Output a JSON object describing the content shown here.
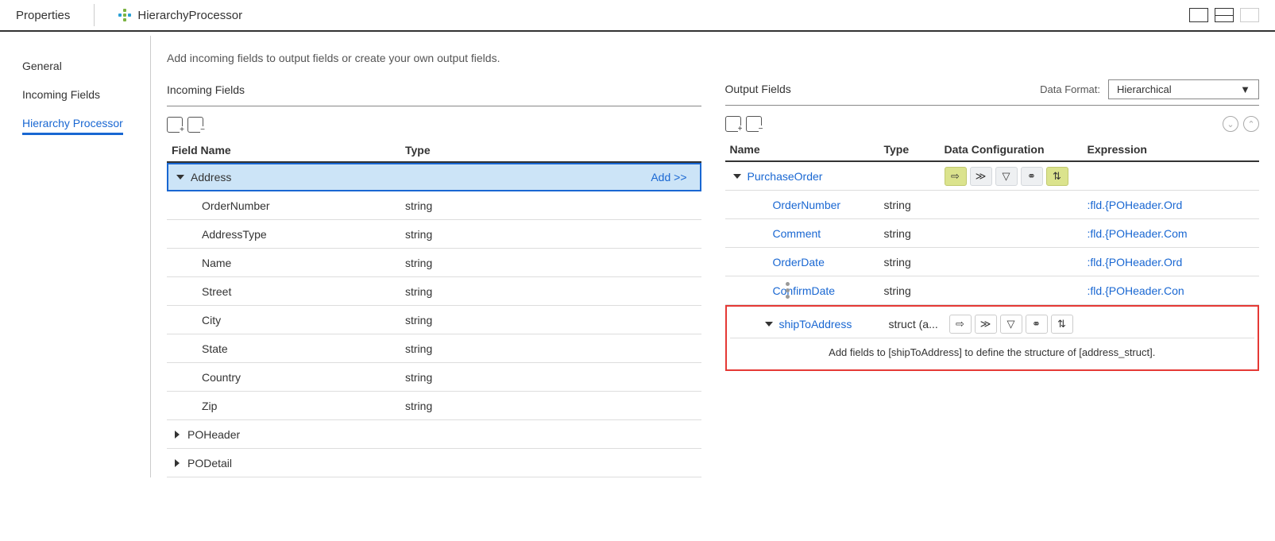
{
  "header": {
    "propertiesLabel": "Properties",
    "processorName": "HierarchyProcessor"
  },
  "sidebar": {
    "items": [
      {
        "label": "General"
      },
      {
        "label": "Incoming Fields"
      },
      {
        "label": "Hierarchy Processor"
      }
    ]
  },
  "instruction": "Add incoming fields to output fields or create your own output fields.",
  "incoming": {
    "title": "Incoming Fields",
    "cols": {
      "name": "Field Name",
      "type": "Type"
    },
    "addAction": "Add >>",
    "rootAddress": {
      "name": "Address"
    },
    "addressChildren": [
      {
        "name": "OrderNumber",
        "type": "string"
      },
      {
        "name": "AddressType",
        "type": "string"
      },
      {
        "name": "Name",
        "type": "string"
      },
      {
        "name": "Street",
        "type": "string"
      },
      {
        "name": "City",
        "type": "string"
      },
      {
        "name": "State",
        "type": "string"
      },
      {
        "name": "Country",
        "type": "string"
      },
      {
        "name": "Zip",
        "type": "string"
      }
    ],
    "collapsed": [
      {
        "name": "POHeader"
      },
      {
        "name": "PODetail"
      }
    ]
  },
  "output": {
    "title": "Output Fields",
    "dataFormatLabel": "Data Format:",
    "dataFormatValue": "Hierarchical",
    "cols": {
      "name": "Name",
      "type": "Type",
      "config": "Data Configuration",
      "expr": "Expression"
    },
    "root": {
      "name": "PurchaseOrder"
    },
    "children": [
      {
        "name": "OrderNumber",
        "type": "string",
        "expr": ":fld.{POHeader.Ord"
      },
      {
        "name": "Comment",
        "type": "string",
        "expr": ":fld.{POHeader.Com"
      },
      {
        "name": "OrderDate",
        "type": "string",
        "expr": ":fld.{POHeader.Ord"
      },
      {
        "name": "ConfirmDate",
        "type": "string",
        "expr": ":fld.{POHeader.Con"
      }
    ],
    "shipTo": {
      "name": "shipToAddress",
      "type": "struct (a..."
    },
    "assistMsg": "Add fields to [shipToAddress] to define the structure of [address_struct]."
  }
}
